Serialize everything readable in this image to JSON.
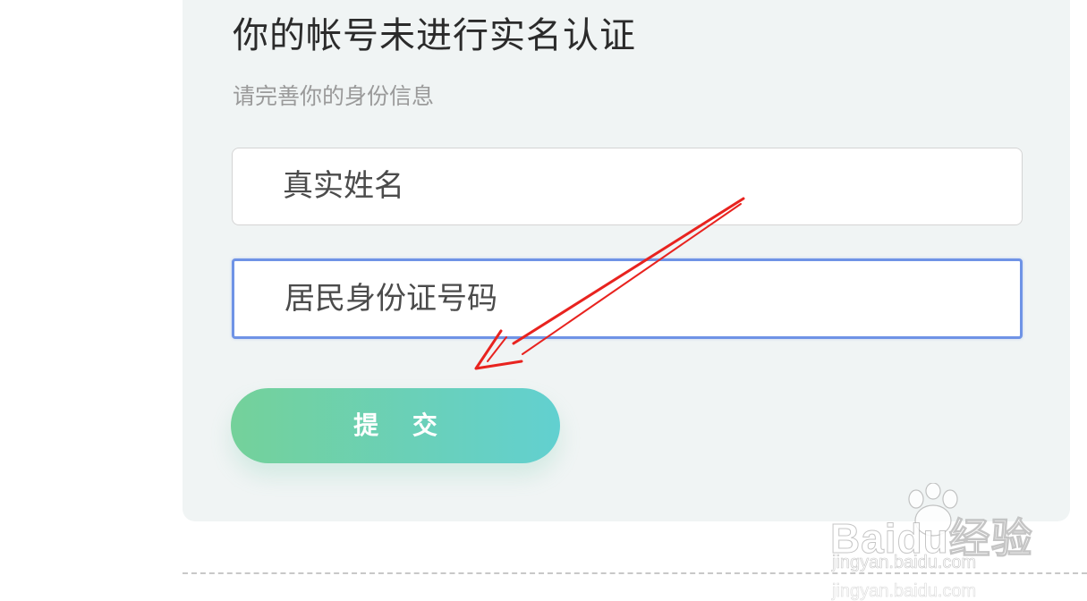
{
  "form": {
    "title": "你的帐号未进行实名认证",
    "subtitle": "请完善你的身份信息",
    "name_placeholder": "真实姓名",
    "id_placeholder": "居民身份证号码",
    "submit_label": "提 交"
  },
  "watermark": {
    "brand": "Baidu经验",
    "url": "jingyan.baidu.com"
  },
  "colors": {
    "card_bg": "#f0f4f4",
    "focus_border": "#6f93e6",
    "button_gradient_start": "#74d19a",
    "button_gradient_end": "#62d0d0",
    "annotation_arrow": "#e8231f"
  },
  "icons": {
    "annotation": "red-arrow-icon",
    "watermark": "baidu-paw-icon"
  }
}
